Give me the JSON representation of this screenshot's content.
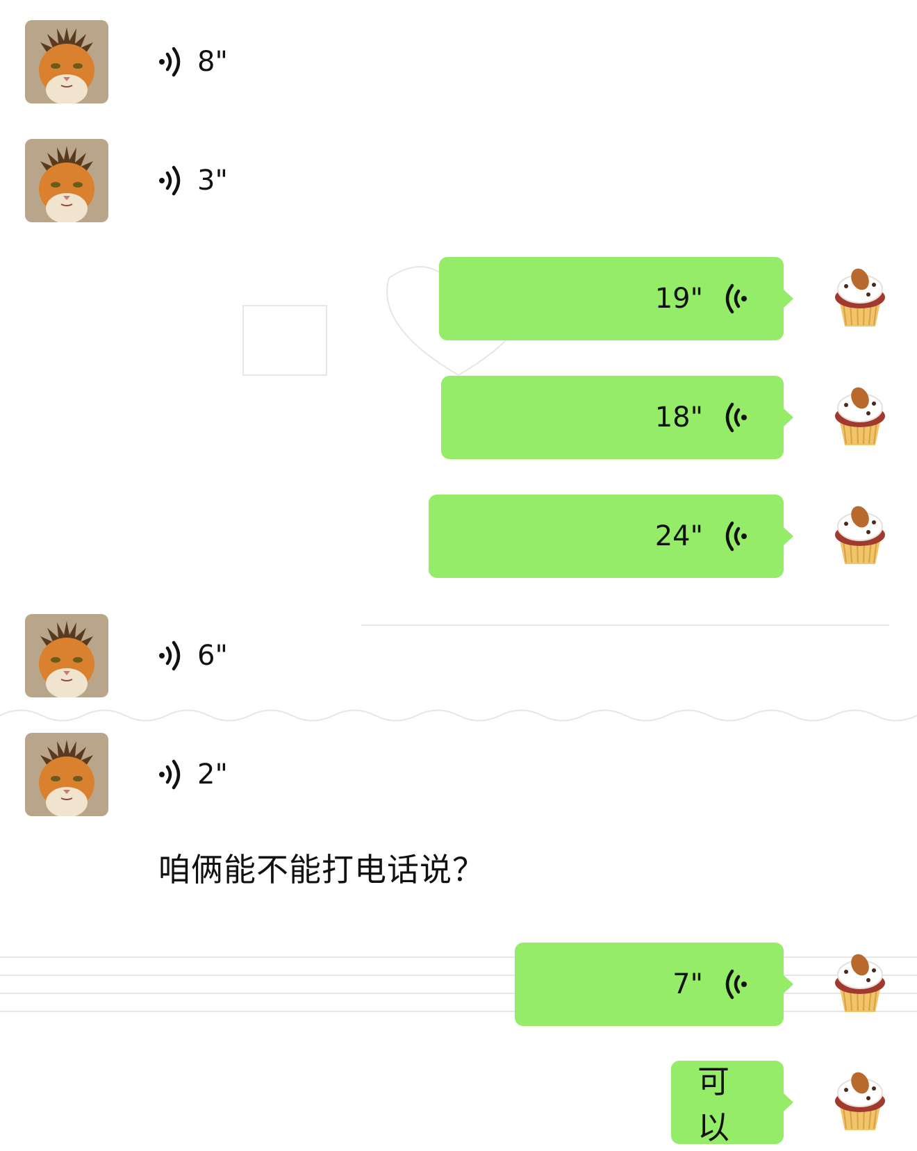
{
  "messages": {
    "m1": {
      "duration": "8\""
    },
    "m2": {
      "duration": "3\""
    },
    "m3": {
      "duration": "19\""
    },
    "m4": {
      "duration": "18\""
    },
    "m5": {
      "duration": "24\""
    },
    "m6": {
      "duration": "6\""
    },
    "m7": {
      "duration": "2\""
    },
    "m8": {
      "text": "咱俩能不能打电话说？"
    },
    "m9": {
      "duration": "7\""
    },
    "m10": {
      "text": "可以"
    }
  },
  "colors": {
    "sent_bubble": "#95ec69",
    "background": "#ffffff",
    "text": "#111111"
  },
  "icons": {
    "received_voice": "voice-wave-right-icon",
    "sent_voice": "voice-wave-left-icon",
    "contact_avatar": "orange-cat-avatar",
    "self_avatar": "cupcake-avatar"
  }
}
